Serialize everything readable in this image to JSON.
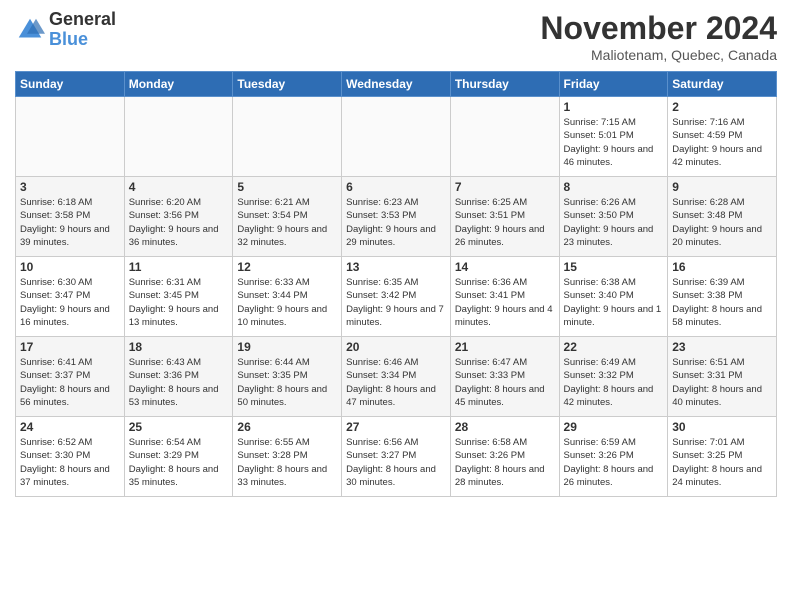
{
  "header": {
    "logo_line1": "General",
    "logo_line2": "Blue",
    "month": "November 2024",
    "location": "Maliotenam, Quebec, Canada"
  },
  "days_of_week": [
    "Sunday",
    "Monday",
    "Tuesday",
    "Wednesday",
    "Thursday",
    "Friday",
    "Saturday"
  ],
  "weeks": [
    [
      {
        "day": "",
        "info": ""
      },
      {
        "day": "",
        "info": ""
      },
      {
        "day": "",
        "info": ""
      },
      {
        "day": "",
        "info": ""
      },
      {
        "day": "",
        "info": ""
      },
      {
        "day": "1",
        "info": "Sunrise: 7:15 AM\nSunset: 5:01 PM\nDaylight: 9 hours and 46 minutes."
      },
      {
        "day": "2",
        "info": "Sunrise: 7:16 AM\nSunset: 4:59 PM\nDaylight: 9 hours and 42 minutes."
      }
    ],
    [
      {
        "day": "3",
        "info": "Sunrise: 6:18 AM\nSunset: 3:58 PM\nDaylight: 9 hours and 39 minutes."
      },
      {
        "day": "4",
        "info": "Sunrise: 6:20 AM\nSunset: 3:56 PM\nDaylight: 9 hours and 36 minutes."
      },
      {
        "day": "5",
        "info": "Sunrise: 6:21 AM\nSunset: 3:54 PM\nDaylight: 9 hours and 32 minutes."
      },
      {
        "day": "6",
        "info": "Sunrise: 6:23 AM\nSunset: 3:53 PM\nDaylight: 9 hours and 29 minutes."
      },
      {
        "day": "7",
        "info": "Sunrise: 6:25 AM\nSunset: 3:51 PM\nDaylight: 9 hours and 26 minutes."
      },
      {
        "day": "8",
        "info": "Sunrise: 6:26 AM\nSunset: 3:50 PM\nDaylight: 9 hours and 23 minutes."
      },
      {
        "day": "9",
        "info": "Sunrise: 6:28 AM\nSunset: 3:48 PM\nDaylight: 9 hours and 20 minutes."
      }
    ],
    [
      {
        "day": "10",
        "info": "Sunrise: 6:30 AM\nSunset: 3:47 PM\nDaylight: 9 hours and 16 minutes."
      },
      {
        "day": "11",
        "info": "Sunrise: 6:31 AM\nSunset: 3:45 PM\nDaylight: 9 hours and 13 minutes."
      },
      {
        "day": "12",
        "info": "Sunrise: 6:33 AM\nSunset: 3:44 PM\nDaylight: 9 hours and 10 minutes."
      },
      {
        "day": "13",
        "info": "Sunrise: 6:35 AM\nSunset: 3:42 PM\nDaylight: 9 hours and 7 minutes."
      },
      {
        "day": "14",
        "info": "Sunrise: 6:36 AM\nSunset: 3:41 PM\nDaylight: 9 hours and 4 minutes."
      },
      {
        "day": "15",
        "info": "Sunrise: 6:38 AM\nSunset: 3:40 PM\nDaylight: 9 hours and 1 minute."
      },
      {
        "day": "16",
        "info": "Sunrise: 6:39 AM\nSunset: 3:38 PM\nDaylight: 8 hours and 58 minutes."
      }
    ],
    [
      {
        "day": "17",
        "info": "Sunrise: 6:41 AM\nSunset: 3:37 PM\nDaylight: 8 hours and 56 minutes."
      },
      {
        "day": "18",
        "info": "Sunrise: 6:43 AM\nSunset: 3:36 PM\nDaylight: 8 hours and 53 minutes."
      },
      {
        "day": "19",
        "info": "Sunrise: 6:44 AM\nSunset: 3:35 PM\nDaylight: 8 hours and 50 minutes."
      },
      {
        "day": "20",
        "info": "Sunrise: 6:46 AM\nSunset: 3:34 PM\nDaylight: 8 hours and 47 minutes."
      },
      {
        "day": "21",
        "info": "Sunrise: 6:47 AM\nSunset: 3:33 PM\nDaylight: 8 hours and 45 minutes."
      },
      {
        "day": "22",
        "info": "Sunrise: 6:49 AM\nSunset: 3:32 PM\nDaylight: 8 hours and 42 minutes."
      },
      {
        "day": "23",
        "info": "Sunrise: 6:51 AM\nSunset: 3:31 PM\nDaylight: 8 hours and 40 minutes."
      }
    ],
    [
      {
        "day": "24",
        "info": "Sunrise: 6:52 AM\nSunset: 3:30 PM\nDaylight: 8 hours and 37 minutes."
      },
      {
        "day": "25",
        "info": "Sunrise: 6:54 AM\nSunset: 3:29 PM\nDaylight: 8 hours and 35 minutes."
      },
      {
        "day": "26",
        "info": "Sunrise: 6:55 AM\nSunset: 3:28 PM\nDaylight: 8 hours and 33 minutes."
      },
      {
        "day": "27",
        "info": "Sunrise: 6:56 AM\nSunset: 3:27 PM\nDaylight: 8 hours and 30 minutes."
      },
      {
        "day": "28",
        "info": "Sunrise: 6:58 AM\nSunset: 3:26 PM\nDaylight: 8 hours and 28 minutes."
      },
      {
        "day": "29",
        "info": "Sunrise: 6:59 AM\nSunset: 3:26 PM\nDaylight: 8 hours and 26 minutes."
      },
      {
        "day": "30",
        "info": "Sunrise: 7:01 AM\nSunset: 3:25 PM\nDaylight: 8 hours and 24 minutes."
      }
    ]
  ]
}
